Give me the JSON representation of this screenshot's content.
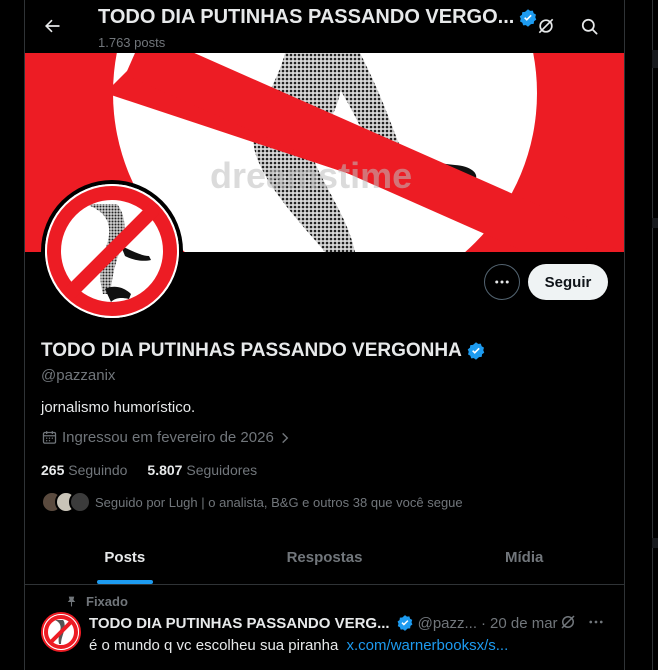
{
  "header": {
    "title": "TODO DIA PUTINHAS PASSANDO VERGO...",
    "post_count": "1.763 posts"
  },
  "profile": {
    "name": "TODO DIA PUTINHAS PASSANDO VERGONHA",
    "handle": "@pazzanix",
    "bio": "jornalismo humorístico.",
    "joined": "Ingressou em fevereiro de 2026",
    "following_count": "265",
    "following_label": "Seguindo",
    "followers_count": "5.807",
    "followers_label": "Seguidores",
    "followed_by": "Seguido por Lugh | o analista, B&G e outros 38 que você segue",
    "follow_button": "Seguir",
    "banner_watermark": "dreamstime"
  },
  "tabs": [
    {
      "label": "Posts",
      "active": true
    },
    {
      "label": "Respostas",
      "active": false
    },
    {
      "label": "Mídia",
      "active": false
    }
  ],
  "pinned_post": {
    "pinned_label": "Fixado",
    "author": "TODO DIA PUTINHAS PASSANDO VERG...",
    "handle": "@pazz...",
    "separator": "·",
    "date": "20 de mar",
    "text": "é o mundo q vc escolheu sua piranha",
    "link": "x.com/warnerbooksx/s..."
  },
  "colors": {
    "accent": "#1d9bf0",
    "banner_red": "#ed1c24",
    "background": "#000000"
  }
}
